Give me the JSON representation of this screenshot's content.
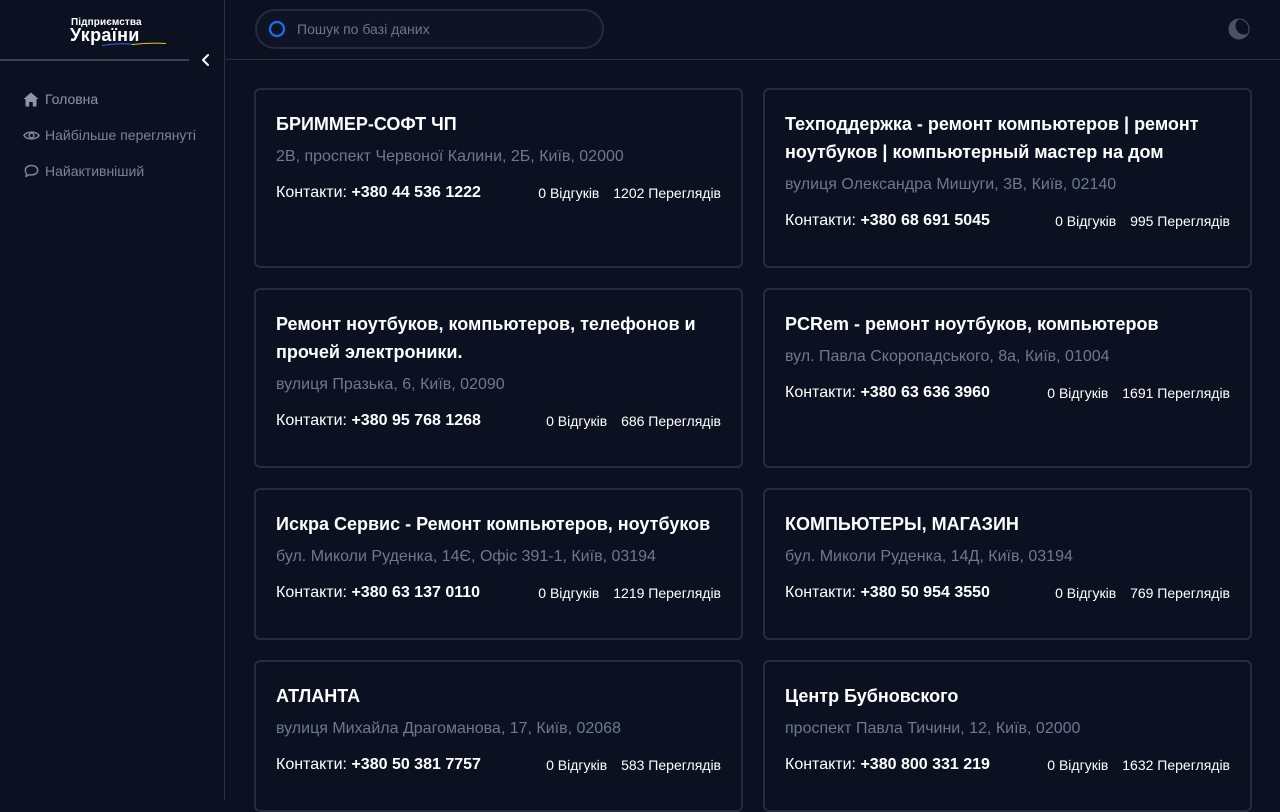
{
  "brand": {
    "top": "Підприємства",
    "main": "України"
  },
  "sidebar": {
    "items": [
      {
        "label": "Головна",
        "icon": "home-icon"
      },
      {
        "label": "Найбільше переглянуті",
        "icon": "eye-icon"
      },
      {
        "label": "Найактивніший",
        "icon": "chat-icon"
      }
    ]
  },
  "search": {
    "placeholder": "Пошук по базі даних",
    "value": ""
  },
  "colors": {
    "accent": "#1f6feb",
    "flag_blue": "#2f6fd6",
    "flag_yellow": "#f2c515"
  },
  "contacts_label": "Контакти:",
  "cards": [
    {
      "title": "БРИММЕР-СОФТ ЧП",
      "address": "2В, проспект Червоної Калини, 2Б, Київ, 02000",
      "phone": "+380 44 536 1222",
      "reviews": "0 Відгуків",
      "views": "1202 Переглядів"
    },
    {
      "title": "Техподдержка - ремонт компьютеров | ремонт ноутбуков | компьютерный мастер на дом",
      "address": "вулиця Олександра Мишуги, 3В, Київ, 02140",
      "phone": "+380 68 691 5045",
      "reviews": "0 Відгуків",
      "views": "995 Переглядів"
    },
    {
      "title": "Ремонт ноутбуков, компьютеров, телефонов и прочей электроники.",
      "address": "вулиця Празька, 6, Київ, 02090",
      "phone": "+380 95 768 1268",
      "reviews": "0 Відгуків",
      "views": "686 Переглядів"
    },
    {
      "title": "PCRem - ремонт ноутбуков, компьютеров",
      "address": "вул. Павла Скоропадського, 8а, Київ, 01004",
      "phone": "+380 63 636 3960",
      "reviews": "0 Відгуків",
      "views": "1691 Переглядів"
    },
    {
      "title": "Искра Сервис - Ремонт компьютеров, ноутбуков",
      "address": "бул. Миколи Руденка, 14Є, Офіс 391-1, Київ, 03194",
      "phone": "+380 63 137 0110",
      "reviews": "0 Відгуків",
      "views": "1219 Переглядів"
    },
    {
      "title": "КОМПЬЮТЕРЫ, МАГАЗИН",
      "address": "бул. Миколи Руденка, 14Д, Київ, 03194",
      "phone": "+380 50 954 3550",
      "reviews": "0 Відгуків",
      "views": "769 Переглядів"
    },
    {
      "title": "АТЛАНТА",
      "address": "вулиця Михайла Драгоманова, 17, Київ, 02068",
      "phone": "+380 50 381 7757",
      "reviews": "0 Відгуків",
      "views": "583 Переглядів"
    },
    {
      "title": "Центр Бубновского",
      "address": "проспект Павла Тичини, 12, Київ, 02000",
      "phone": "+380 800 331 219",
      "reviews": "0 Відгуків",
      "views": "1632 Переглядів"
    }
  ]
}
